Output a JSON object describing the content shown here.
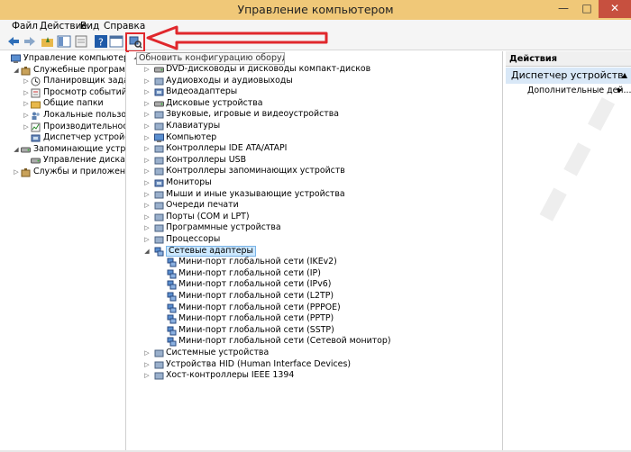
{
  "window": {
    "title": "Управление компьютером"
  },
  "menu": [
    {
      "label": "Файл"
    },
    {
      "label": "Действие"
    },
    {
      "label": "Вид"
    },
    {
      "label": "Справка"
    }
  ],
  "tooltip": {
    "text": "Обновить конфигурацию оборудования"
  },
  "left_tree": [
    {
      "label": "Управление компьютером (л",
      "level": 0,
      "arrow": ""
    },
    {
      "label": "Служебные программы",
      "level": 1,
      "arrow": "◢"
    },
    {
      "label": "Планировщик заданий",
      "level": 2,
      "arrow": "▷"
    },
    {
      "label": "Просмотр событий",
      "level": 2,
      "arrow": "▷"
    },
    {
      "label": "Общие папки",
      "level": 2,
      "arrow": "▷"
    },
    {
      "label": "Локальные пользовате",
      "level": 2,
      "arrow": "▷"
    },
    {
      "label": "Производительность",
      "level": 2,
      "arrow": "▷"
    },
    {
      "label": "Диспетчер устройств",
      "level": 2,
      "arrow": ""
    },
    {
      "label": "Запоминающие устройст",
      "level": 1,
      "arrow": "◢"
    },
    {
      "label": "Управление дисками",
      "level": 2,
      "arrow": ""
    },
    {
      "label": "Службы и приложения",
      "level": 1,
      "arrow": "▷"
    }
  ],
  "devices": [
    {
      "label": "DVD-дисководы и дисководы компакт-дисков",
      "arrow": "▷",
      "level": 0
    },
    {
      "label": "Аудиовходы и аудиовыходы",
      "arrow": "▷",
      "level": 0
    },
    {
      "label": "Видеоадаптеры",
      "arrow": "▷",
      "level": 0
    },
    {
      "label": "Дисковые устройства",
      "arrow": "▷",
      "level": 0
    },
    {
      "label": "Звуковые, игровые и видеоустройства",
      "arrow": "▷",
      "level": 0
    },
    {
      "label": "Клавиатуры",
      "arrow": "▷",
      "level": 0
    },
    {
      "label": "Компьютер",
      "arrow": "▷",
      "level": 0
    },
    {
      "label": "Контроллеры IDE ATA/ATAPI",
      "arrow": "▷",
      "level": 0
    },
    {
      "label": "Контроллеры USB",
      "arrow": "▷",
      "level": 0
    },
    {
      "label": "Контроллеры запоминающих устройств",
      "arrow": "▷",
      "level": 0
    },
    {
      "label": "Мониторы",
      "arrow": "▷",
      "level": 0
    },
    {
      "label": "Мыши и иные указывающие устройства",
      "arrow": "▷",
      "level": 0
    },
    {
      "label": "Очереди печати",
      "arrow": "▷",
      "level": 0
    },
    {
      "label": "Порты (COM и LPT)",
      "arrow": "▷",
      "level": 0
    },
    {
      "label": "Программные устройства",
      "arrow": "▷",
      "level": 0
    },
    {
      "label": "Процессоры",
      "arrow": "▷",
      "level": 0
    },
    {
      "label": "Сетевые адаптеры",
      "arrow": "◢",
      "level": 0,
      "selected": true
    },
    {
      "label": "Мини-порт глобальной сети (IKEv2)",
      "arrow": "",
      "level": 1
    },
    {
      "label": "Мини-порт глобальной сети (IP)",
      "arrow": "",
      "level": 1
    },
    {
      "label": "Мини-порт глобальной сети (IPv6)",
      "arrow": "",
      "level": 1
    },
    {
      "label": "Мини-порт глобальной сети (L2TP)",
      "arrow": "",
      "level": 1
    },
    {
      "label": "Мини-порт глобальной сети (PPPOE)",
      "arrow": "",
      "level": 1
    },
    {
      "label": "Мини-порт глобальной сети (PPTP)",
      "arrow": "",
      "level": 1
    },
    {
      "label": "Мини-порт глобальной сети (SSTP)",
      "arrow": "",
      "level": 1
    },
    {
      "label": "Мини-порт глобальной сети (Сетевой монитор)",
      "arrow": "",
      "level": 1
    },
    {
      "label": "Системные устройства",
      "arrow": "▷",
      "level": 0
    },
    {
      "label": "Устройства HID (Human Interface Devices)",
      "arrow": "▷",
      "level": 0
    },
    {
      "label": "Хост-контроллеры IEEE 1394",
      "arrow": "▷",
      "level": 0
    }
  ],
  "actions": {
    "header": "Действия",
    "group": "Диспетчер устройств",
    "item": "Дополнительные дей..."
  },
  "colors": {
    "titlebar": "#f0c878",
    "close": "#c7503f",
    "annotation": "#e0282c",
    "selection": "#cce8ff"
  }
}
